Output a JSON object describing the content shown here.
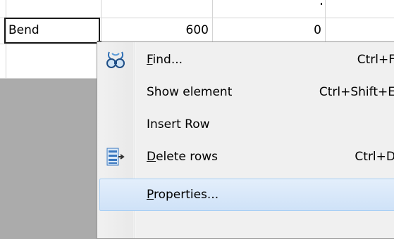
{
  "grid": {
    "row": {
      "name": "Bend",
      "value1": "600",
      "value2": "0"
    }
  },
  "context_menu": {
    "items": [
      {
        "label_accel": "F",
        "label_rest": "ind...",
        "shortcut": "Ctrl+F",
        "icon": "binoculars-icon"
      },
      {
        "label_accel": "",
        "label_rest": "Show element",
        "shortcut": "Ctrl+Shift+E",
        "icon": ""
      },
      {
        "label_accel": "",
        "label_rest": "Insert Row",
        "shortcut": "",
        "icon": "",
        "has_submenu": true
      },
      {
        "label_accel": "D",
        "label_rest": "elete rows",
        "shortcut": "Ctrl+D",
        "icon": "delete-rows-icon"
      },
      {
        "label_accel": "P",
        "label_rest": "roperties...",
        "shortcut": "",
        "icon": "",
        "highlighted": true
      }
    ]
  },
  "colors": {
    "highlight_border": "#a8cff5",
    "gray_area": "#ababab",
    "menu_bg": "#f0f0f0"
  }
}
